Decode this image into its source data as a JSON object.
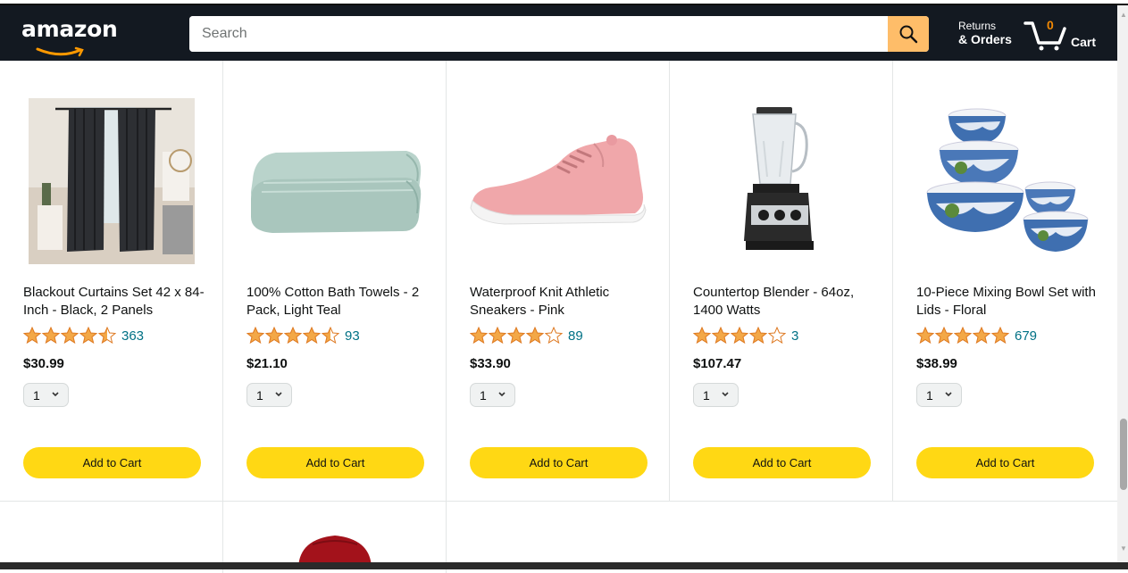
{
  "header": {
    "logo": "amazon",
    "search_placeholder": "Search",
    "returns_line1": "Returns",
    "returns_line2": "& Orders",
    "cart_count": "0",
    "cart_label": "Cart"
  },
  "products": [
    {
      "title": "Blackout Curtains Set 42 x 84-Inch - Black, 2 Panels",
      "rating": 4.5,
      "reviews": "363",
      "price": "$30.99",
      "qty": "1",
      "button": "Add to Cart",
      "image": "curtains-image"
    },
    {
      "title": "100% Cotton Bath Towels - 2 Pack, Light Teal",
      "rating": 4.5,
      "reviews": "93",
      "price": "$21.10",
      "qty": "1",
      "button": "Add to Cart",
      "image": "towels-image"
    },
    {
      "title": "Waterproof Knit Athletic Sneakers - Pink",
      "rating": 4,
      "reviews": "89",
      "price": "$33.90",
      "qty": "1",
      "button": "Add to Cart",
      "image": "sneaker-image"
    },
    {
      "title": "Countertop Blender - 64oz, 1400 Watts",
      "rating": 4,
      "reviews": "3",
      "price": "$107.47",
      "qty": "1",
      "button": "Add to Cart",
      "image": "blender-image"
    },
    {
      "title": "10-Piece Mixing Bowl Set with Lids - Floral",
      "rating": 5,
      "reviews": "679",
      "price": "$38.99",
      "qty": "1",
      "button": "Add to Cart",
      "image": "bowls-image"
    }
  ],
  "colors": {
    "header_bg": "#131921",
    "search_button": "#febd69",
    "star": "#f3a847",
    "link": "#007185",
    "add_button": "#ffd814"
  }
}
